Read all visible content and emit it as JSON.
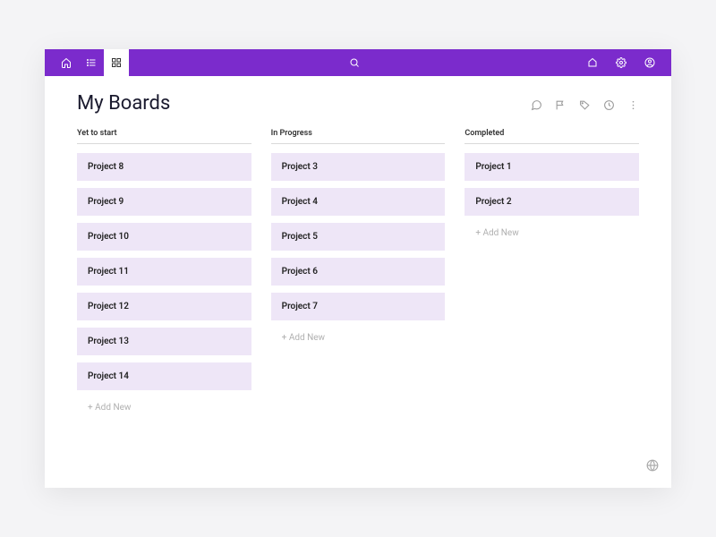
{
  "colors": {
    "accent": "#7b2bcc",
    "card": "#eee6f7"
  },
  "page": {
    "title": "My Boards"
  },
  "add_new_label": "+ Add New",
  "columns": [
    {
      "title": "Yet to start",
      "cards": [
        "Project 8",
        "Project 9",
        "Project 10",
        "Project 11",
        "Project 12",
        "Project 13",
        "Project 14"
      ]
    },
    {
      "title": "In Progress",
      "cards": [
        "Project 3",
        "Project 4",
        "Project 5",
        "Project 6",
        "Project 7"
      ]
    },
    {
      "title": "Completed",
      "cards": [
        "Project 1",
        "Project 2"
      ]
    }
  ]
}
